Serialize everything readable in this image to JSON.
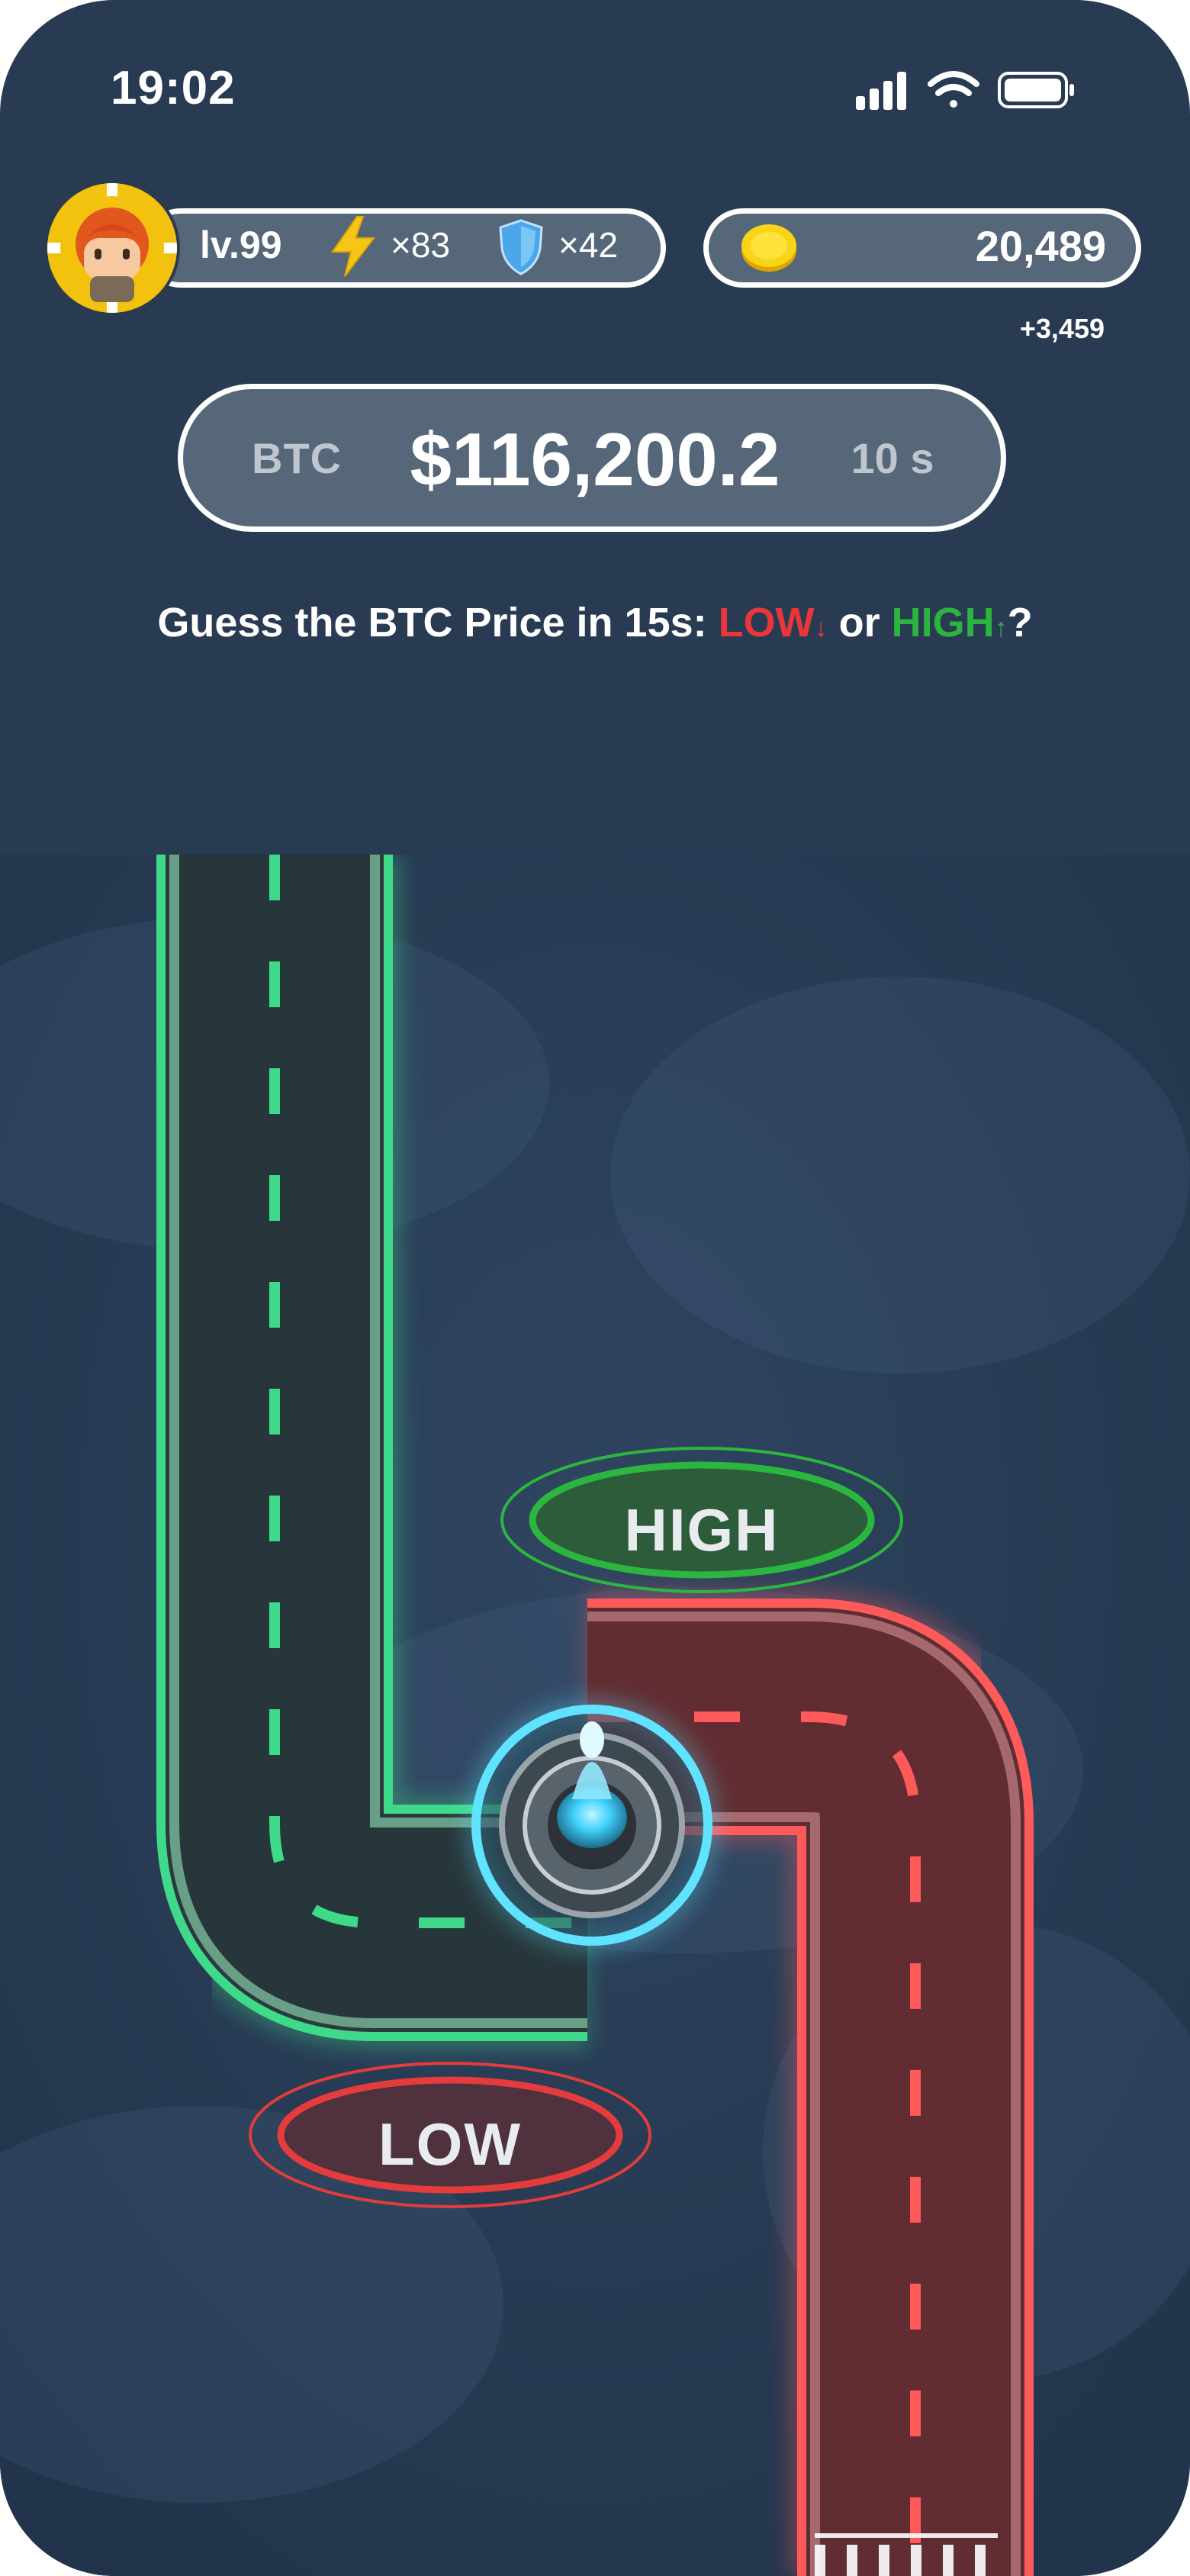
{
  "status_bar": {
    "time": "19:02",
    "icons": [
      "signal-bars-icon",
      "wifi-icon",
      "battery-icon"
    ]
  },
  "player": {
    "level": "lv.99",
    "energy": "×83",
    "shield": "×42",
    "avatar": "avatar-icon"
  },
  "wallet": {
    "coins": "20,489",
    "delta": "+3,459",
    "icon": "coin-icon"
  },
  "price": {
    "asset": "BTC",
    "value": "$116,200.2",
    "timer": "10 s"
  },
  "question": {
    "prefix": "Guess the BTC Price in 15s: ",
    "low": "LOW",
    "low_arrow": "↓",
    "middle": " or ",
    "high": "HIGH",
    "high_arrow": "↑",
    "suffix": "?"
  },
  "board": {
    "high_label": "HIGH",
    "low_label": "LOW",
    "colors": {
      "high": "#3fd98a",
      "low": "#ff5a5a",
      "marker": "#5fe3ff",
      "background": "#293b52"
    }
  }
}
